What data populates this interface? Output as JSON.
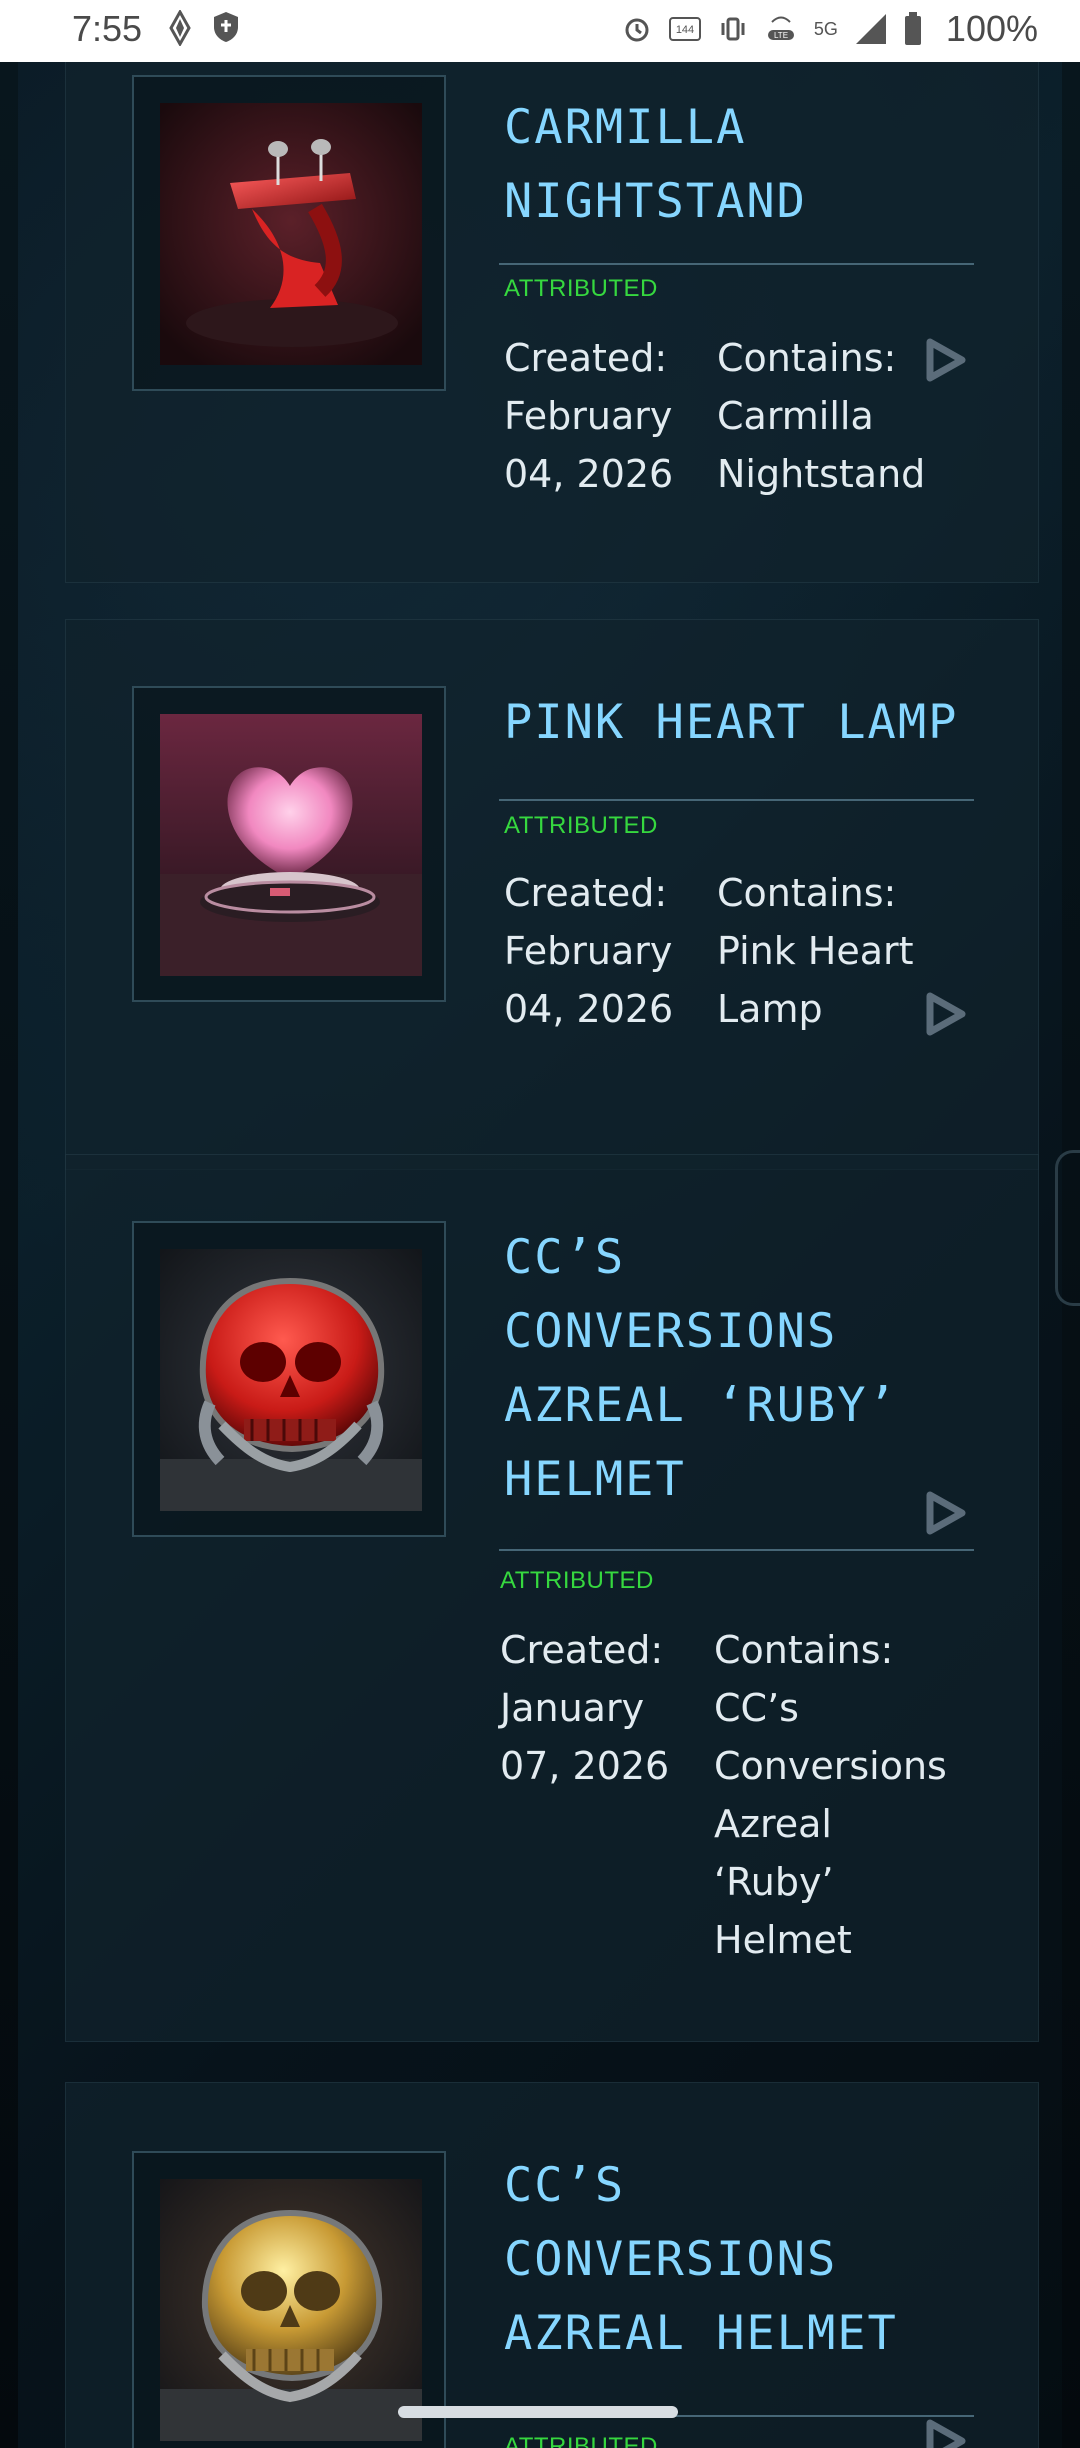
{
  "status_bar": {
    "time": "7:55",
    "battery": "100%",
    "network_badge": "5G",
    "rate_badge": "144 Hz"
  },
  "items": [
    {
      "title": "CARMILLA NIGHTSTAND",
      "status": "ATTRIBUTED",
      "created_label": "Created:",
      "created_line1": "February",
      "created_line2": "04, 2026",
      "contains_label": "Contains:",
      "contains_line1": "Carmilla",
      "contains_line2": "Nightstand"
    },
    {
      "title": "PINK HEART LAMP",
      "status": "ATTRIBUTED",
      "created_label": "Created:",
      "created_line1": "February",
      "created_line2": "04, 2026",
      "contains_label": "Contains:",
      "contains_line1": "Pink Heart",
      "contains_line2": "Lamp"
    },
    {
      "title": "CC'S CONVERSIONS AZREAL 'RUBY' HELMET",
      "title_line1": "CC’S",
      "title_line2": "CONVERSIONS",
      "title_line3": "AZREAL ‘RUBY’",
      "title_line4": "HELMET",
      "status": "ATTRIBUTED",
      "created_label": "Created:",
      "created_line1": "January",
      "created_line2": "07, 2026",
      "contains_label": "Contains:",
      "contains_line1": "CC’s",
      "contains_line2": "Conversions",
      "contains_line3": "Azreal",
      "contains_line4": "‘Ruby’",
      "contains_line5": "Helmet"
    },
    {
      "title": "CC'S CONVERSIONS AZREAL HELMET",
      "title_line1": "CC’S",
      "title_line2": "CONVERSIONS",
      "title_line3": "AZREAL HELMET",
      "status": "ATTRIBUTED"
    }
  ],
  "colors": {
    "title": "#86d6ff",
    "attributed": "#36d83f",
    "card": "#11232d"
  },
  "icons": {
    "play": "play-triangle-icon",
    "thumbnail": "item-thumbnail"
  }
}
